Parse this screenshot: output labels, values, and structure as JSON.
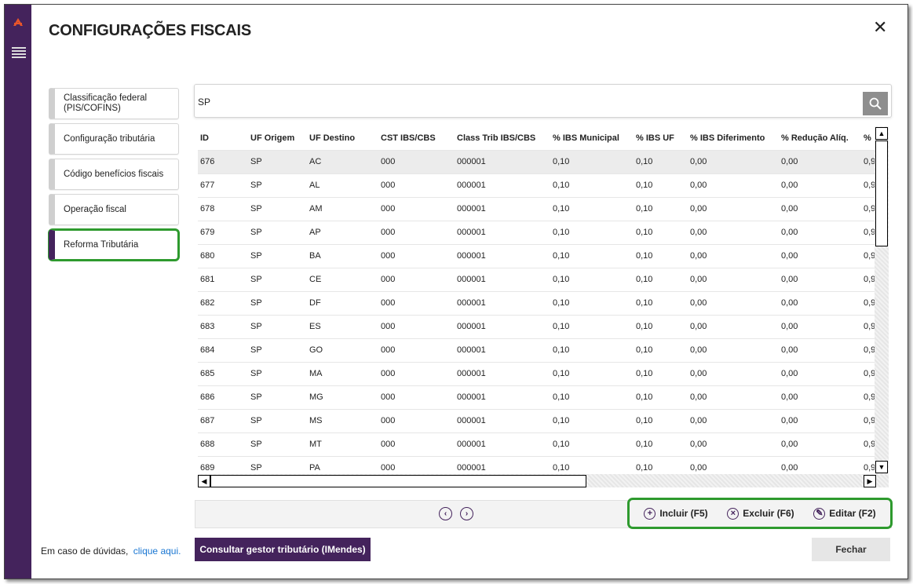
{
  "window": {
    "title": "CONFIGURAÇÕES FISCAIS",
    "close_glyph": "✕"
  },
  "nav": {
    "items": [
      {
        "label": "Classificação federal (PIS/COFINS)",
        "active": false
      },
      {
        "label": "Configuração tributária",
        "active": false
      },
      {
        "label": "Código benefícios fiscais",
        "active": false
      },
      {
        "label": "Operação fiscal",
        "active": false
      },
      {
        "label": "Reforma Tributária",
        "active": true
      }
    ]
  },
  "search": {
    "value": "SP",
    "icon": "search-icon"
  },
  "table": {
    "columns": [
      "ID",
      "UF Origem",
      "UF Destino",
      "CST IBS/CBS",
      "Class Trib IBS/CBS",
      "% IBS Municipal",
      "% IBS UF",
      "% IBS Diferimento",
      "% Redução Alíq.",
      "%"
    ],
    "rows": [
      [
        "676",
        "SP",
        "AC",
        "000",
        "000001",
        "0,10",
        "0,10",
        "0,00",
        "0,00",
        "0,9"
      ],
      [
        "677",
        "SP",
        "AL",
        "000",
        "000001",
        "0,10",
        "0,10",
        "0,00",
        "0,00",
        "0,9"
      ],
      [
        "678",
        "SP",
        "AM",
        "000",
        "000001",
        "0,10",
        "0,10",
        "0,00",
        "0,00",
        "0,9"
      ],
      [
        "679",
        "SP",
        "AP",
        "000",
        "000001",
        "0,10",
        "0,10",
        "0,00",
        "0,00",
        "0,9"
      ],
      [
        "680",
        "SP",
        "BA",
        "000",
        "000001",
        "0,10",
        "0,10",
        "0,00",
        "0,00",
        "0,9"
      ],
      [
        "681",
        "SP",
        "CE",
        "000",
        "000001",
        "0,10",
        "0,10",
        "0,00",
        "0,00",
        "0,9"
      ],
      [
        "682",
        "SP",
        "DF",
        "000",
        "000001",
        "0,10",
        "0,10",
        "0,00",
        "0,00",
        "0,9"
      ],
      [
        "683",
        "SP",
        "ES",
        "000",
        "000001",
        "0,10",
        "0,10",
        "0,00",
        "0,00",
        "0,9"
      ],
      [
        "684",
        "SP",
        "GO",
        "000",
        "000001",
        "0,10",
        "0,10",
        "0,00",
        "0,00",
        "0,9"
      ],
      [
        "685",
        "SP",
        "MA",
        "000",
        "000001",
        "0,10",
        "0,10",
        "0,00",
        "0,00",
        "0,9"
      ],
      [
        "686",
        "SP",
        "MG",
        "000",
        "000001",
        "0,10",
        "0,10",
        "0,00",
        "0,00",
        "0,9"
      ],
      [
        "687",
        "SP",
        "MS",
        "000",
        "000001",
        "0,10",
        "0,10",
        "0,00",
        "0,00",
        "0,9"
      ],
      [
        "688",
        "SP",
        "MT",
        "000",
        "000001",
        "0,10",
        "0,10",
        "0,00",
        "0,00",
        "0,9"
      ],
      [
        "689",
        "SP",
        "PA",
        "000",
        "000001",
        "0,10",
        "0,10",
        "0,00",
        "0,00",
        "0,9"
      ]
    ],
    "selected_row": 0
  },
  "pager": {
    "prev_glyph": "‹",
    "next_glyph": "›"
  },
  "actions": {
    "include": {
      "label": "Incluir (F5)",
      "glyph": "+"
    },
    "delete": {
      "label": "Excluir (F6)",
      "glyph": "×"
    },
    "edit": {
      "label": "Editar (F2)",
      "glyph": "✎"
    }
  },
  "footer": {
    "help_text": "Em caso de dúvidas,",
    "help_link": "clique aqui.",
    "consult_button": "Consultar gestor tributário (IMendes)",
    "close_button": "Fechar"
  },
  "colors": {
    "brand": "#44235c",
    "highlight": "#2e9a2e",
    "link": "#1976d2"
  }
}
